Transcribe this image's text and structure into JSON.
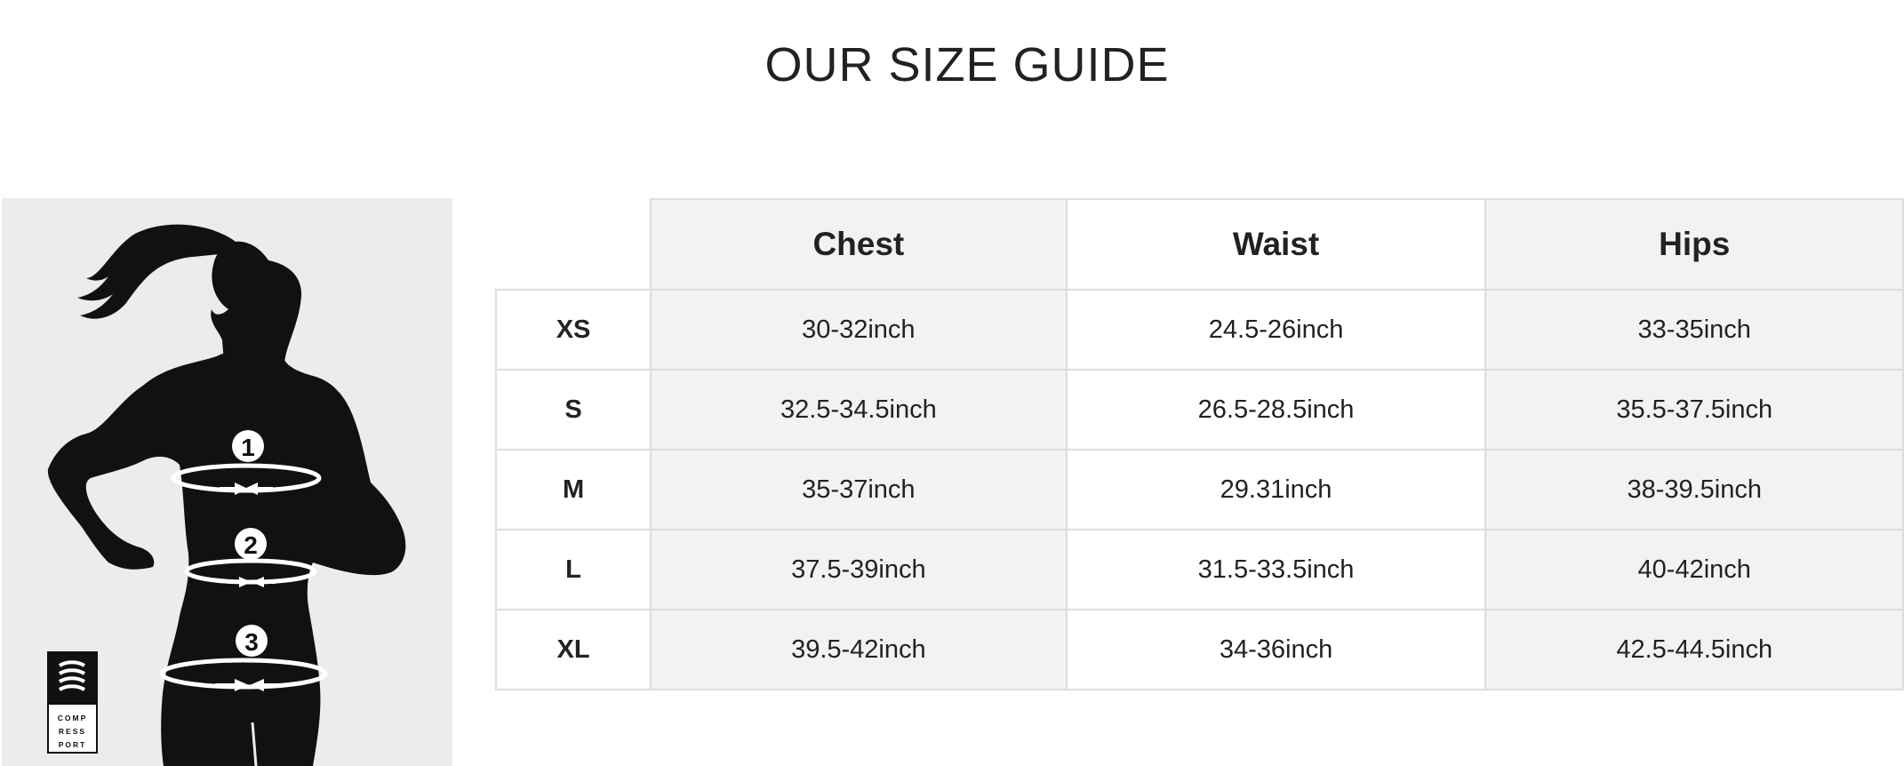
{
  "title": "OUR SIZE GUIDE",
  "illustration": {
    "figure": "running-woman-silhouette",
    "markers": [
      "1",
      "2",
      "3"
    ],
    "logo": {
      "icon": "compressport-waves-icon",
      "lines": [
        "COMP",
        "RESS",
        "PORT"
      ]
    }
  },
  "table": {
    "headers": [
      "Chest",
      "Waist",
      "Hips"
    ],
    "rows": [
      {
        "size": "XS",
        "chest": "30-32inch",
        "waist": "24.5-26inch",
        "hips": "33-35inch"
      },
      {
        "size": "S",
        "chest": "32.5-34.5inch",
        "waist": "26.5-28.5inch",
        "hips": "35.5-37.5inch"
      },
      {
        "size": "M",
        "chest": "35-37inch",
        "waist": "29.31inch",
        "hips": "38-39.5inch"
      },
      {
        "size": "L",
        "chest": "37.5-39inch",
        "waist": "31.5-33.5inch",
        "hips": "40-42inch"
      },
      {
        "size": "XL",
        "chest": "39.5-42inch",
        "waist": "34-36inch",
        "hips": "42.5-44.5inch"
      }
    ]
  },
  "colors": {
    "shaded_cell": "#f2f2f2",
    "border": "#dddddd",
    "illustration_bg": "#ececec",
    "text": "#222222"
  }
}
